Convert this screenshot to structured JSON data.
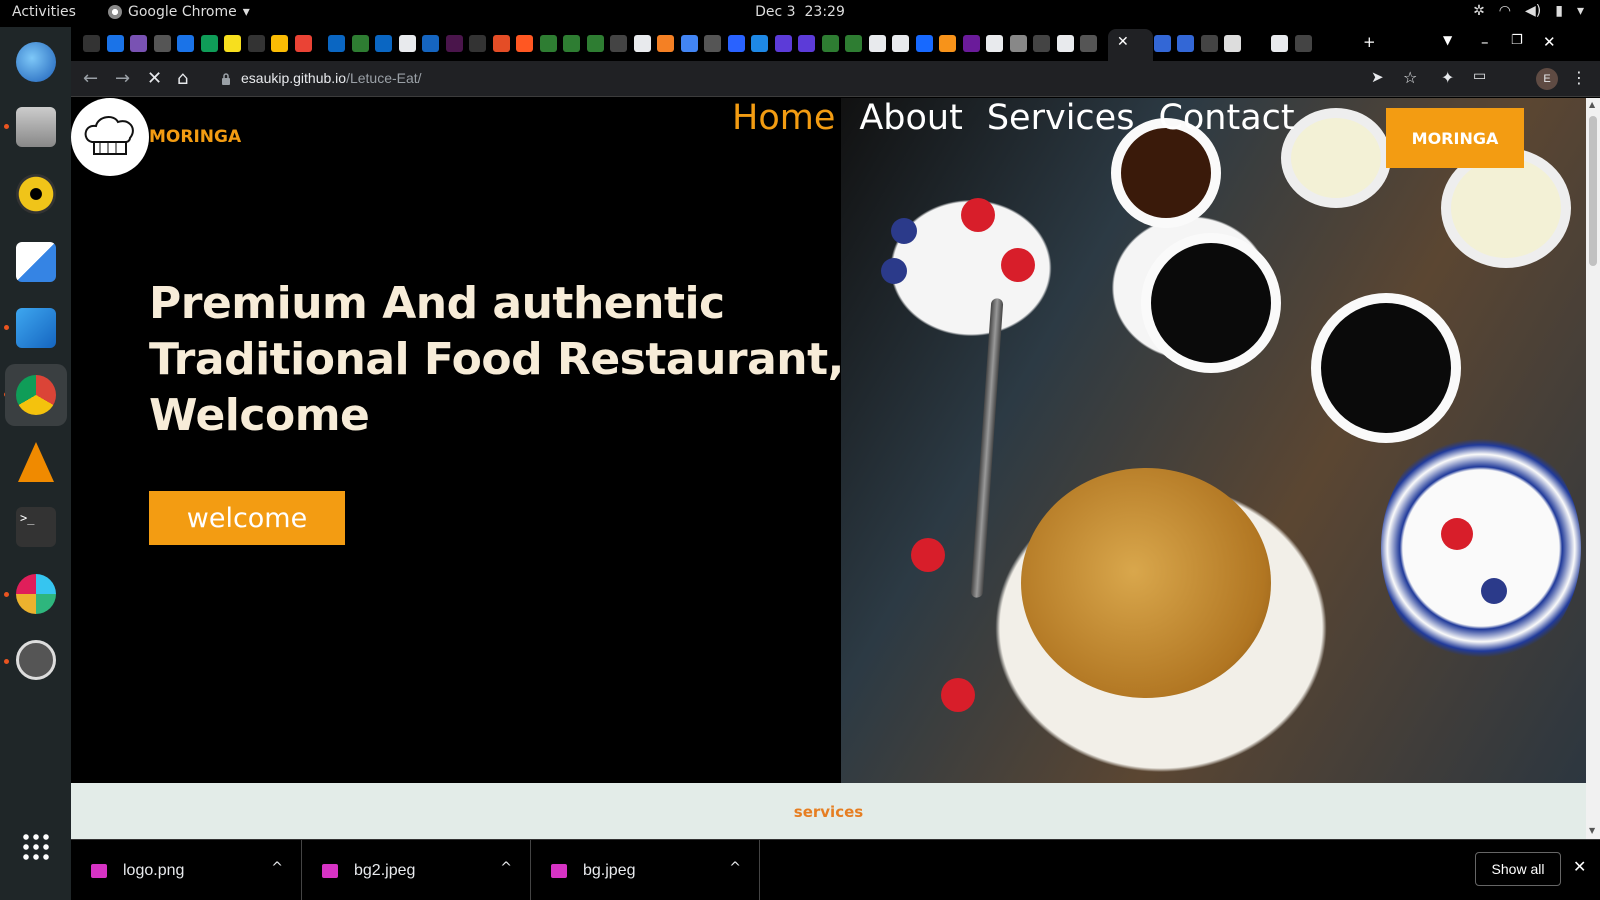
{
  "os_topbar": {
    "activities": "Activities",
    "app_name": "Google Chrome",
    "date": "Dec 3",
    "time": "23:29"
  },
  "browser": {
    "url_host": "esaukip.github.io",
    "url_path": "/Letuce-Eat/",
    "avatar_letter": "E",
    "favicons": [
      "medium",
      "youtube",
      "bootstrap",
      "globe",
      "help",
      "drive",
      "js",
      "medium",
      "bulb",
      "gmail",
      "linkedin",
      "tree",
      "linkedin",
      "c",
      "3",
      "slack",
      "medium",
      "html5",
      "fsg",
      "w",
      "tree",
      "tree",
      "github",
      "google",
      "stack",
      "docs",
      "latex",
      "hashnode",
      "check",
      "n",
      "n",
      "w",
      "w",
      "google",
      "google",
      "behance",
      "bitcoin",
      "hex",
      "chrome",
      "chrome",
      "github",
      "close",
      "latex",
      "flag",
      "flag",
      "github",
      "img",
      "is",
      "chrome",
      "github"
    ]
  },
  "site": {
    "brand": "MORINGA",
    "nav": [
      {
        "label": "Home",
        "active": true
      },
      {
        "label": "About",
        "active": false
      },
      {
        "label": "Services",
        "active": false
      },
      {
        "label": "Contact",
        "active": false
      }
    ],
    "cta_top": "MORINGA",
    "hero_title": "Premium And authentic Traditional Food Restaurant, Welcome",
    "hero_button": "welcome",
    "services_heading": "services",
    "accent_color": "#f39c12"
  },
  "downloads": {
    "items": [
      "logo.png",
      "bg2.jpeg",
      "bg.jpeg"
    ],
    "show_all": "Show all"
  }
}
